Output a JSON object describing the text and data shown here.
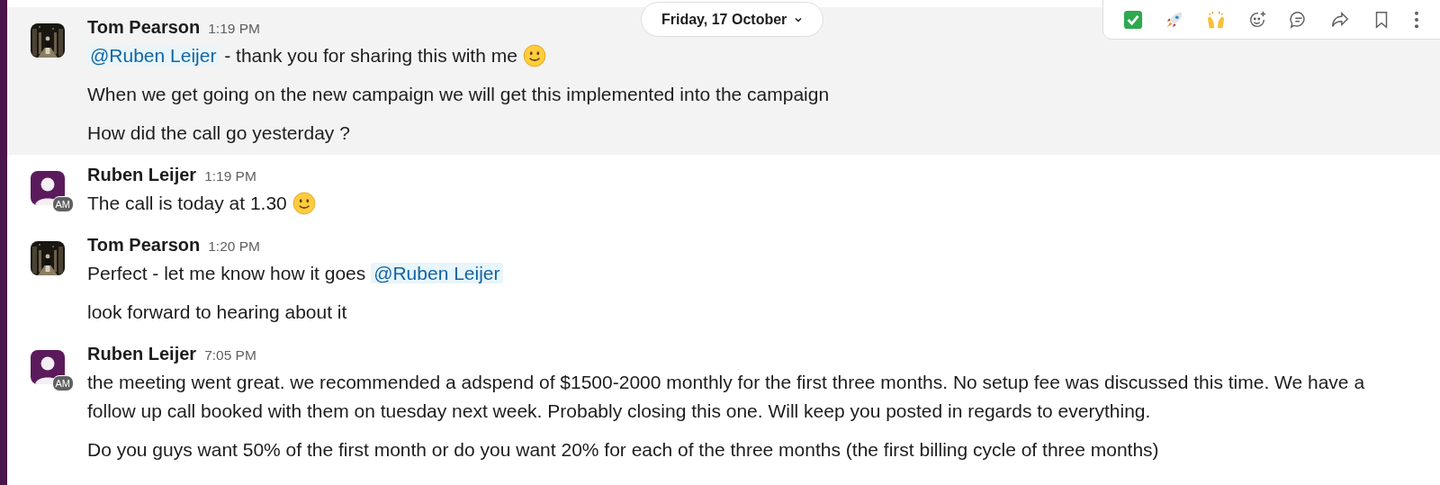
{
  "date_divider": {
    "label": "Friday, 17 October"
  },
  "messages": [
    {
      "author": "Tom Pearson",
      "time": "1:19 PM",
      "avatar": {
        "kind": "picture"
      },
      "highlighted": true,
      "paragraphs": [
        [
          {
            "kind": "mention",
            "text": "@Ruben Leijer"
          },
          {
            "kind": "text",
            "text": " - thank you for sharing this with me "
          },
          {
            "kind": "emoji"
          }
        ],
        [
          {
            "kind": "text",
            "text": "When we get going on the new campaign we will get this implemented into the campaign"
          }
        ],
        [
          {
            "kind": "text",
            "text": "How did the call go yesterday ?"
          }
        ]
      ]
    },
    {
      "author": "Ruben Leijer",
      "time": "1:19 PM",
      "avatar": {
        "kind": "default",
        "badge": "AM"
      },
      "highlighted": false,
      "paragraphs": [
        [
          {
            "kind": "text",
            "text": "The call is today at 1.30 "
          },
          {
            "kind": "emoji"
          }
        ]
      ]
    },
    {
      "author": "Tom Pearson",
      "time": "1:20 PM",
      "avatar": {
        "kind": "picture"
      },
      "highlighted": false,
      "paragraphs": [
        [
          {
            "kind": "text",
            "text": "Perfect - let me know how it goes "
          },
          {
            "kind": "mention",
            "text": "@Ruben Leijer"
          }
        ],
        [
          {
            "kind": "text",
            "text": "look forward to hearing about it"
          }
        ]
      ]
    },
    {
      "author": "Ruben Leijer",
      "time": "7:05 PM",
      "avatar": {
        "kind": "default",
        "badge": "AM"
      },
      "highlighted": false,
      "paragraphs": [
        [
          {
            "kind": "text",
            "text": "the meeting went great. we recommended a adspend of $1500-2000 monthly for the first three months. No setup fee was discussed this time. We have a follow up call booked with them on tuesday next week. Probably closing this one. Will keep you posted in regards to everything."
          }
        ],
        [
          {
            "kind": "text",
            "text": "Do you guys want 50% of the first month or do you want 20% for each of the three months (the first billing cycle of three months)"
          }
        ]
      ]
    }
  ]
}
